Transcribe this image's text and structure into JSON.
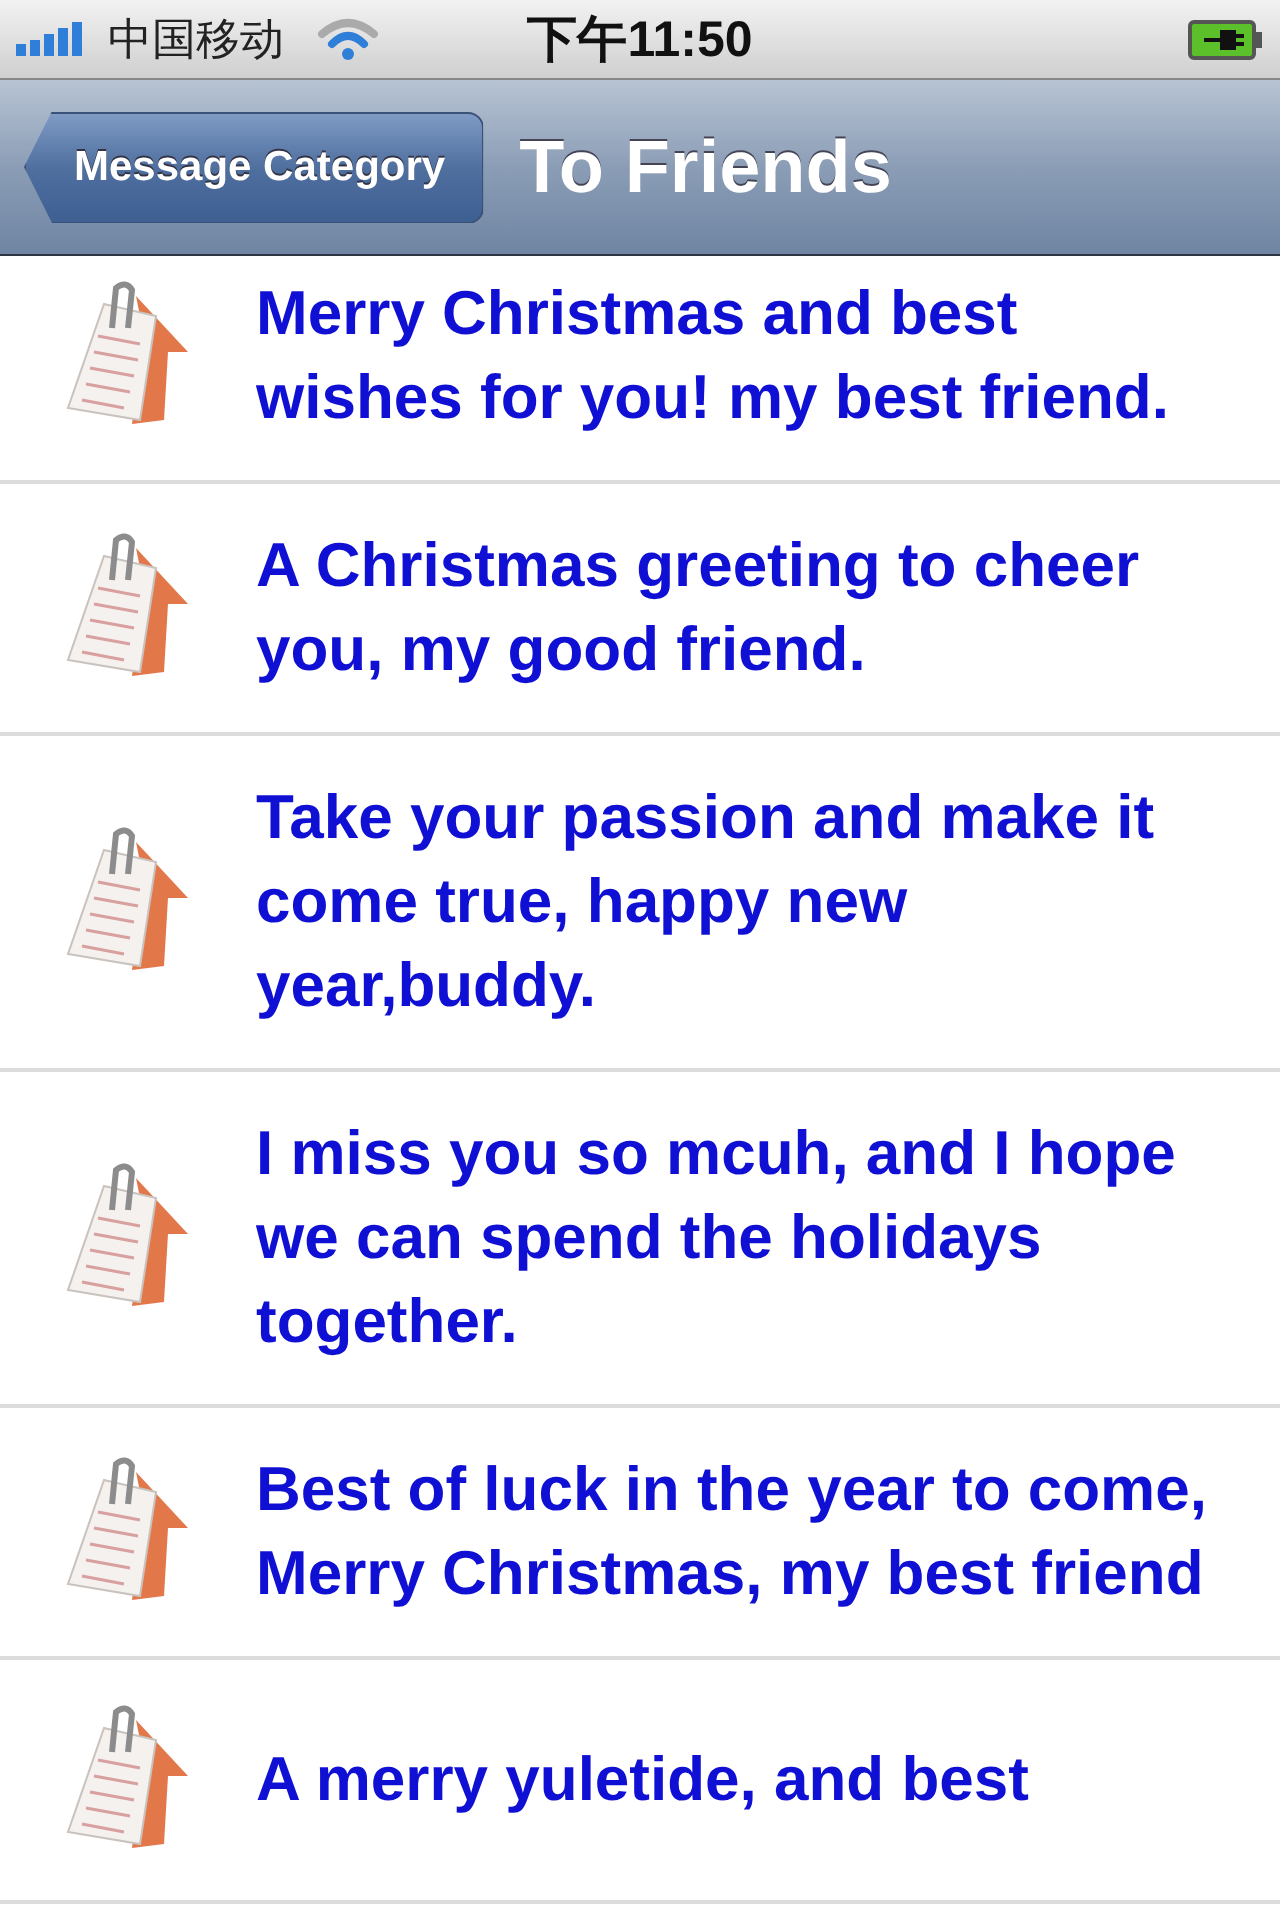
{
  "status_bar": {
    "carrier": "中国移动",
    "time": "下午11:50"
  },
  "nav_bar": {
    "back_button": "Message Category",
    "title": "To Friends"
  },
  "messages": [
    {
      "text": "Merry Christmas and best wishes for you! my best friend."
    },
    {
      "text": "A Christmas greeting to cheer you, my good friend."
    },
    {
      "text": "Take your passion and make it come true, happy new year,buddy."
    },
    {
      "text": "I miss you so mcuh, and I hope we can spend the holidays together."
    },
    {
      "text": "Best of luck in the year to come, Merry Christmas, my best friend"
    },
    {
      "text": "A merry yuletide, and best"
    }
  ]
}
